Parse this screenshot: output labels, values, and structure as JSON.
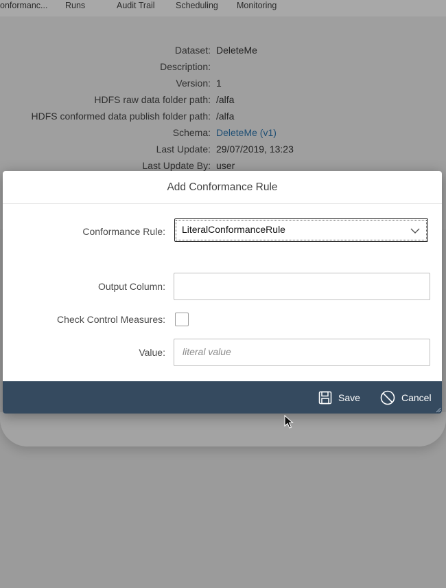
{
  "tabs": [
    "onformanc...",
    "Runs",
    "Audit Trail",
    "Scheduling",
    "Monitoring"
  ],
  "details": [
    {
      "label": "Dataset:",
      "value": "DeleteMe"
    },
    {
      "label": "Description:",
      "value": ""
    },
    {
      "label": "Version:",
      "value": "1"
    },
    {
      "label": "HDFS raw data folder path:",
      "value": "/alfa"
    },
    {
      "label": "HDFS conformed data publish folder path:",
      "value": "/alfa"
    },
    {
      "label": "Schema:",
      "value": "DeleteMe (v1)"
    },
    {
      "label": "Last Update:",
      "value": "29/07/2019, 13:23"
    },
    {
      "label": "Last Update By:",
      "value": "user"
    }
  ],
  "dialog": {
    "title": "Add Conformance Rule",
    "conformance_rule_label": "Conformance Rule:",
    "conformance_rule_value": "LiteralConformanceRule",
    "output_column_label": "Output Column:",
    "output_column_value": "",
    "check_control_label": "Check Control Measures:",
    "check_control_checked": false,
    "value_label": "Value:",
    "value_placeholder": "literal value",
    "save_label": "Save",
    "cancel_label": "Cancel"
  },
  "colors": {
    "footer": "#354a5f",
    "link": "#1f4f74",
    "overlay": "#9d9d9d"
  }
}
